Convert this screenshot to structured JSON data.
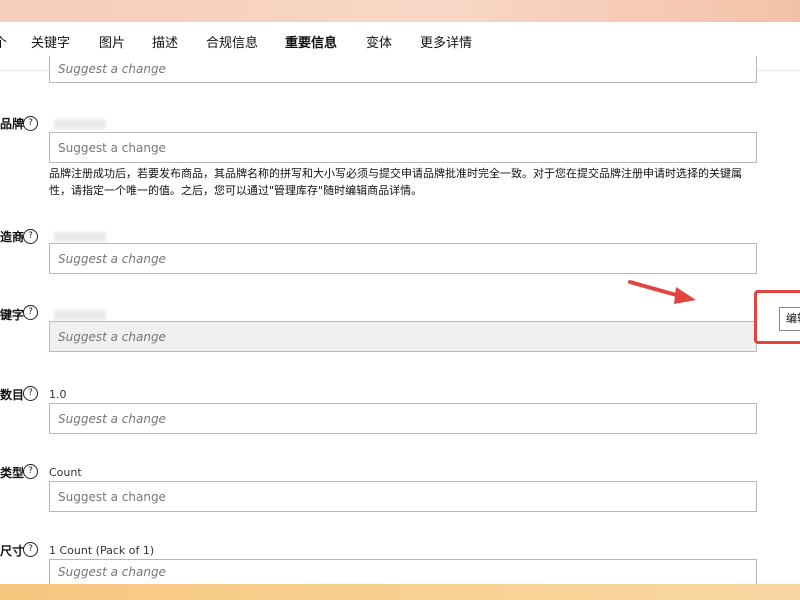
{
  "tabs": {
    "cut": "个",
    "items": [
      "关键字",
      "图片",
      "描述",
      "合规信息",
      "重要信息",
      "变体",
      "更多详情"
    ],
    "active": "重要信息"
  },
  "fields": {
    "top_placeholder": "Suggest a change",
    "brand": {
      "label": "品牌",
      "placeholder": "Suggest a change",
      "description": "品牌注册成功后，若要发布商品，其品牌名称的拼写和大小写必须与提交申请品牌批准时完全一致。对于您在提交品牌注册申请时选择的关键属性，请指定一个唯一的值。之后，您可以通过\"管理库存\"随时编辑商品详情。"
    },
    "manufacturer": {
      "label": "造商",
      "placeholder": "Suggest a change"
    },
    "keyword": {
      "label": "键字",
      "placeholder": "Suggest a change",
      "edit_button": "编辑"
    },
    "quantity": {
      "label": "数目",
      "value": "1.0",
      "placeholder": "Suggest a change"
    },
    "type": {
      "label": "类型",
      "value": "Count",
      "placeholder": "Suggest a change"
    },
    "size": {
      "label": "尺寸",
      "value": "1 Count (Pack of 1)",
      "placeholder": "Suggest a change"
    }
  },
  "help_icon": "?",
  "colors": {
    "accent": "#1f7a72",
    "annotation_red": "#e0453f"
  },
  "icons": [
    "help-icon",
    "red-arrow-annotation"
  ]
}
